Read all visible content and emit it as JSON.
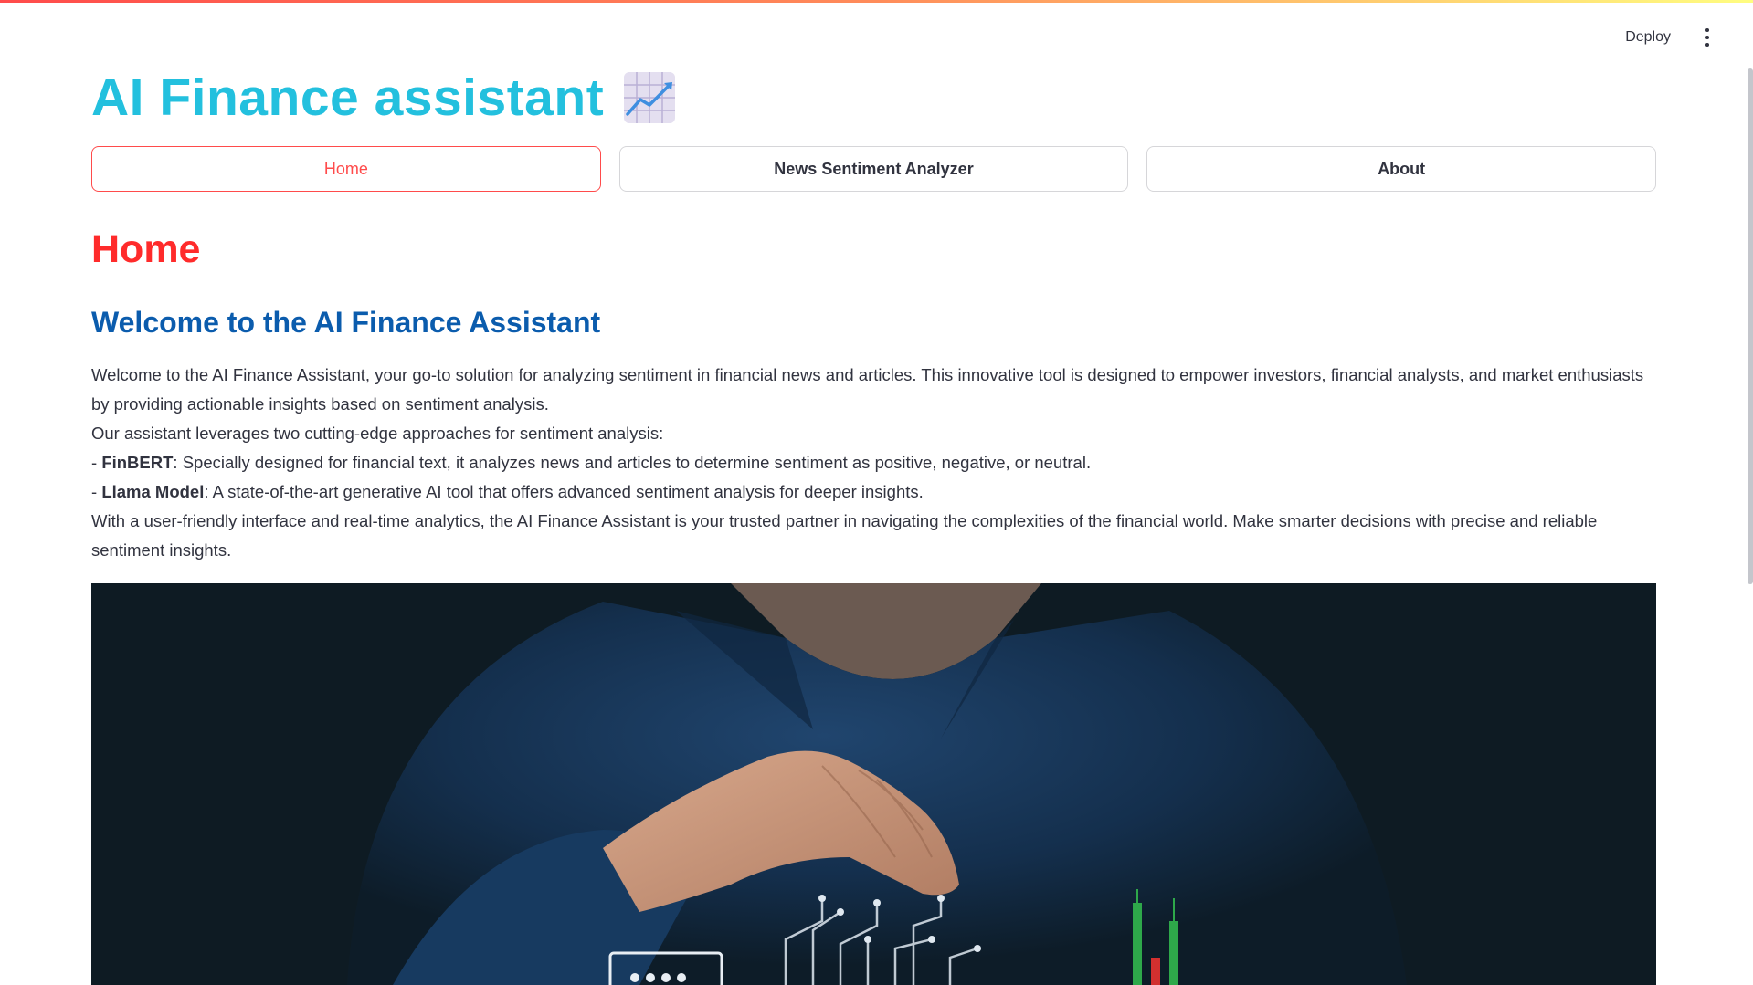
{
  "toolbar": {
    "deploy_label": "Deploy",
    "menu_icon": "more-vertical-icon"
  },
  "app": {
    "title": "AI Finance assistant",
    "title_icon": "chart-increasing-icon",
    "title_color": "#23c0de"
  },
  "nav": {
    "buttons": [
      {
        "label": "Home",
        "active": true
      },
      {
        "label": "News Sentiment Analyzer",
        "active": false
      },
      {
        "label": "About",
        "active": false
      }
    ]
  },
  "page": {
    "heading": "Home",
    "section_heading": "Welcome to the AI Finance Assistant",
    "paragraph_1": "Welcome to the AI Finance Assistant, your go-to solution for analyzing sentiment in financial news and articles. This innovative tool is designed to empower investors, financial analysts, and market enthusiasts by providing actionable insights based on sentiment analysis.",
    "paragraph_2": "Our assistant leverages two cutting-edge approaches for sentiment analysis:",
    "list": [
      {
        "prefix": "- ",
        "term": "FinBERT",
        "text": ": Specially designed for financial text, it analyzes news and articles to determine sentiment as positive, negative, or neutral."
      },
      {
        "prefix": "- ",
        "term": "Llama Model",
        "text": ": A state-of-the-art generative AI tool that offers advanced sentiment analysis for deeper insights."
      }
    ],
    "paragraph_3": "With a user-friendly interface and real-time analytics, the AI Finance Assistant is your trusted partner in navigating the complexities of the financial world. Make smarter decisions with precise and reliable sentiment insights."
  },
  "colors": {
    "accent": "#ff4b4b",
    "heading_red": "#ff2b2b",
    "subheading_blue": "#0b5cad"
  }
}
